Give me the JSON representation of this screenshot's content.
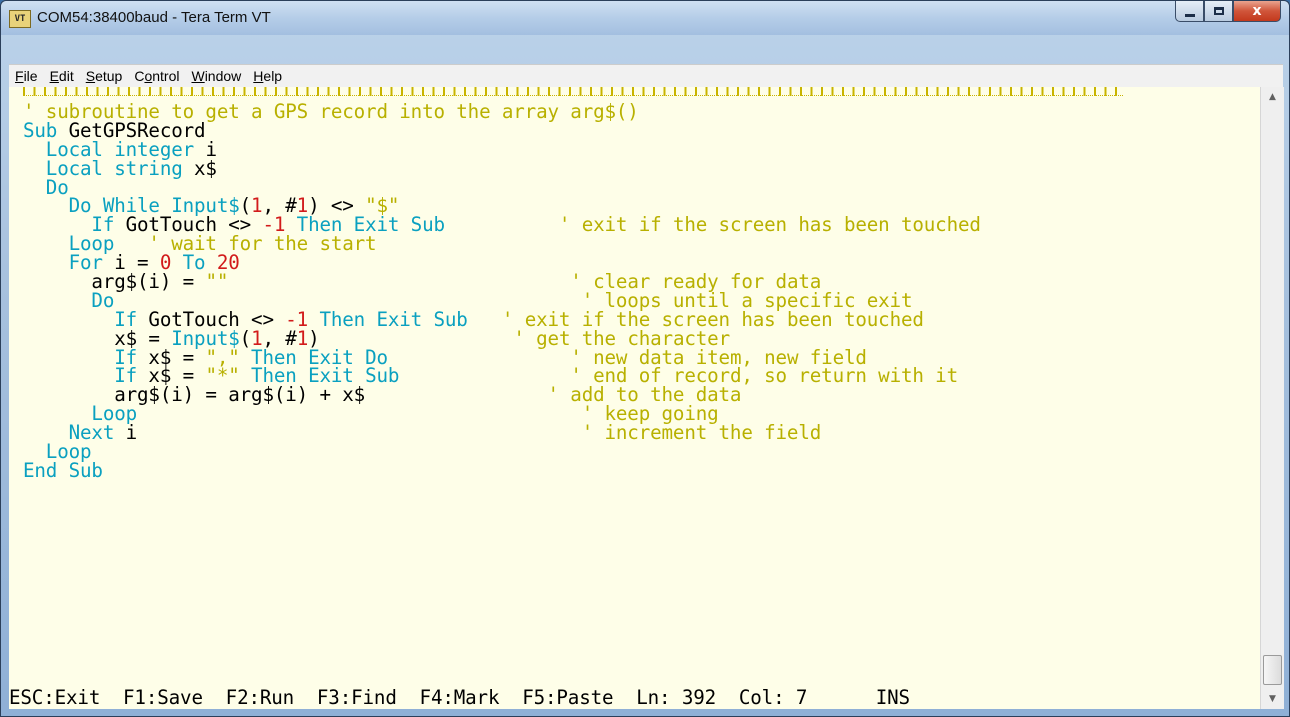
{
  "window": {
    "title": "COM54:38400baud - Tera Term VT",
    "app_icon_text": "VT",
    "close_glyph": "x"
  },
  "menu": [
    {
      "accel": "F",
      "rest": "ile"
    },
    {
      "accel": "E",
      "rest": "dit"
    },
    {
      "accel": "S",
      "rest": "etup"
    },
    {
      "pre": "C",
      "accel": "o",
      "rest": "ntrol"
    },
    {
      "accel": "W",
      "rest": "indow"
    },
    {
      "accel": "H",
      "rest": "elp"
    }
  ],
  "code_lines": [
    [
      [
        "c",
        "' subroutine to get a GPS record into the array arg$()"
      ]
    ],
    [
      [
        "k",
        "Sub "
      ],
      [
        "t",
        "GetGPSRecord"
      ]
    ],
    [
      [
        "k",
        "  Local integer "
      ],
      [
        "t",
        "i"
      ]
    ],
    [
      [
        "k",
        "  Local string "
      ],
      [
        "t",
        "x$"
      ]
    ],
    [
      [
        "k",
        "  Do"
      ]
    ],
    [
      [
        "k",
        "    Do While Input$"
      ],
      [
        "t",
        "("
      ],
      [
        "n",
        "1"
      ],
      [
        "t",
        ", #"
      ],
      [
        "n",
        "1"
      ],
      [
        "t",
        ") <> "
      ],
      [
        "s",
        "\"$\""
      ]
    ],
    [
      [
        "k",
        "      If "
      ],
      [
        "t",
        "GotTouch <> "
      ],
      [
        "n",
        "-1"
      ],
      [
        "k",
        " Then Exit Sub"
      ],
      [
        "c",
        "          ' exit if the screen has been touched"
      ]
    ],
    [
      [
        "k",
        "    Loop"
      ],
      [
        "c",
        "   ' wait for the start"
      ]
    ],
    [
      [
        "k",
        "    For "
      ],
      [
        "t",
        "i = "
      ],
      [
        "n",
        "0"
      ],
      [
        "k",
        " To "
      ],
      [
        "n",
        "20"
      ]
    ],
    [
      [
        "t",
        "      arg$(i) = "
      ],
      [
        "s",
        "\"\""
      ],
      [
        "c",
        "                              ' clear ready for data"
      ]
    ],
    [
      [
        "k",
        "      Do"
      ],
      [
        "c",
        "                                         ' loops until a specific exit"
      ]
    ],
    [
      [
        "k",
        "        If "
      ],
      [
        "t",
        "GotTouch <> "
      ],
      [
        "n",
        "-1"
      ],
      [
        "k",
        " Then Exit Sub"
      ],
      [
        "c",
        "   ' exit if the screen has been touched"
      ]
    ],
    [
      [
        "t",
        "        x$ = "
      ],
      [
        "k",
        "Input$"
      ],
      [
        "t",
        "("
      ],
      [
        "n",
        "1"
      ],
      [
        "t",
        ", #"
      ],
      [
        "n",
        "1"
      ],
      [
        "t",
        ")"
      ],
      [
        "c",
        "                 ' get the character"
      ]
    ],
    [
      [
        "k",
        "        If "
      ],
      [
        "t",
        "x$ = "
      ],
      [
        "s",
        "\",\""
      ],
      [
        "k",
        " Then Exit Do"
      ],
      [
        "c",
        "                ' new data item, new field"
      ]
    ],
    [
      [
        "k",
        "        If "
      ],
      [
        "t",
        "x$ = "
      ],
      [
        "s",
        "\"*\""
      ],
      [
        "k",
        " Then Exit Sub"
      ],
      [
        "c",
        "               ' end of record, so return with it"
      ]
    ],
    [
      [
        "t",
        "        arg$(i) = arg$(i) + x$"
      ],
      [
        "c",
        "                ' add to the data"
      ]
    ],
    [
      [
        "k",
        "      Loop"
      ],
      [
        "c",
        "                                       ' keep going"
      ]
    ],
    [
      [
        "k",
        "    Next "
      ],
      [
        "t",
        "i"
      ],
      [
        "c",
        "                                       ' increment the field"
      ]
    ],
    [
      [
        "k",
        "  Loop"
      ]
    ],
    [
      [
        "k",
        "End Sub"
      ]
    ]
  ],
  "status": {
    "esc": "ESC:Exit",
    "f1": "F1:Save",
    "f2": "F2:Run",
    "f3": "F3:Find",
    "f4": "F4:Mark",
    "f5": "F5:Paste",
    "ln": "Ln: 392",
    "col": "Col: 7",
    "mode": "INS"
  },
  "colors": {
    "comment": "#b8b000",
    "keyword": "#0aa0c0",
    "number": "#d21b1b",
    "text": "#000000",
    "background": "#fefee8"
  },
  "icons": {
    "minimize": "minimize-icon",
    "maximize": "maximize-icon",
    "close": "close-icon",
    "scroll_up": "scroll-up-arrow-icon",
    "scroll_down": "scroll-down-arrow-icon"
  }
}
